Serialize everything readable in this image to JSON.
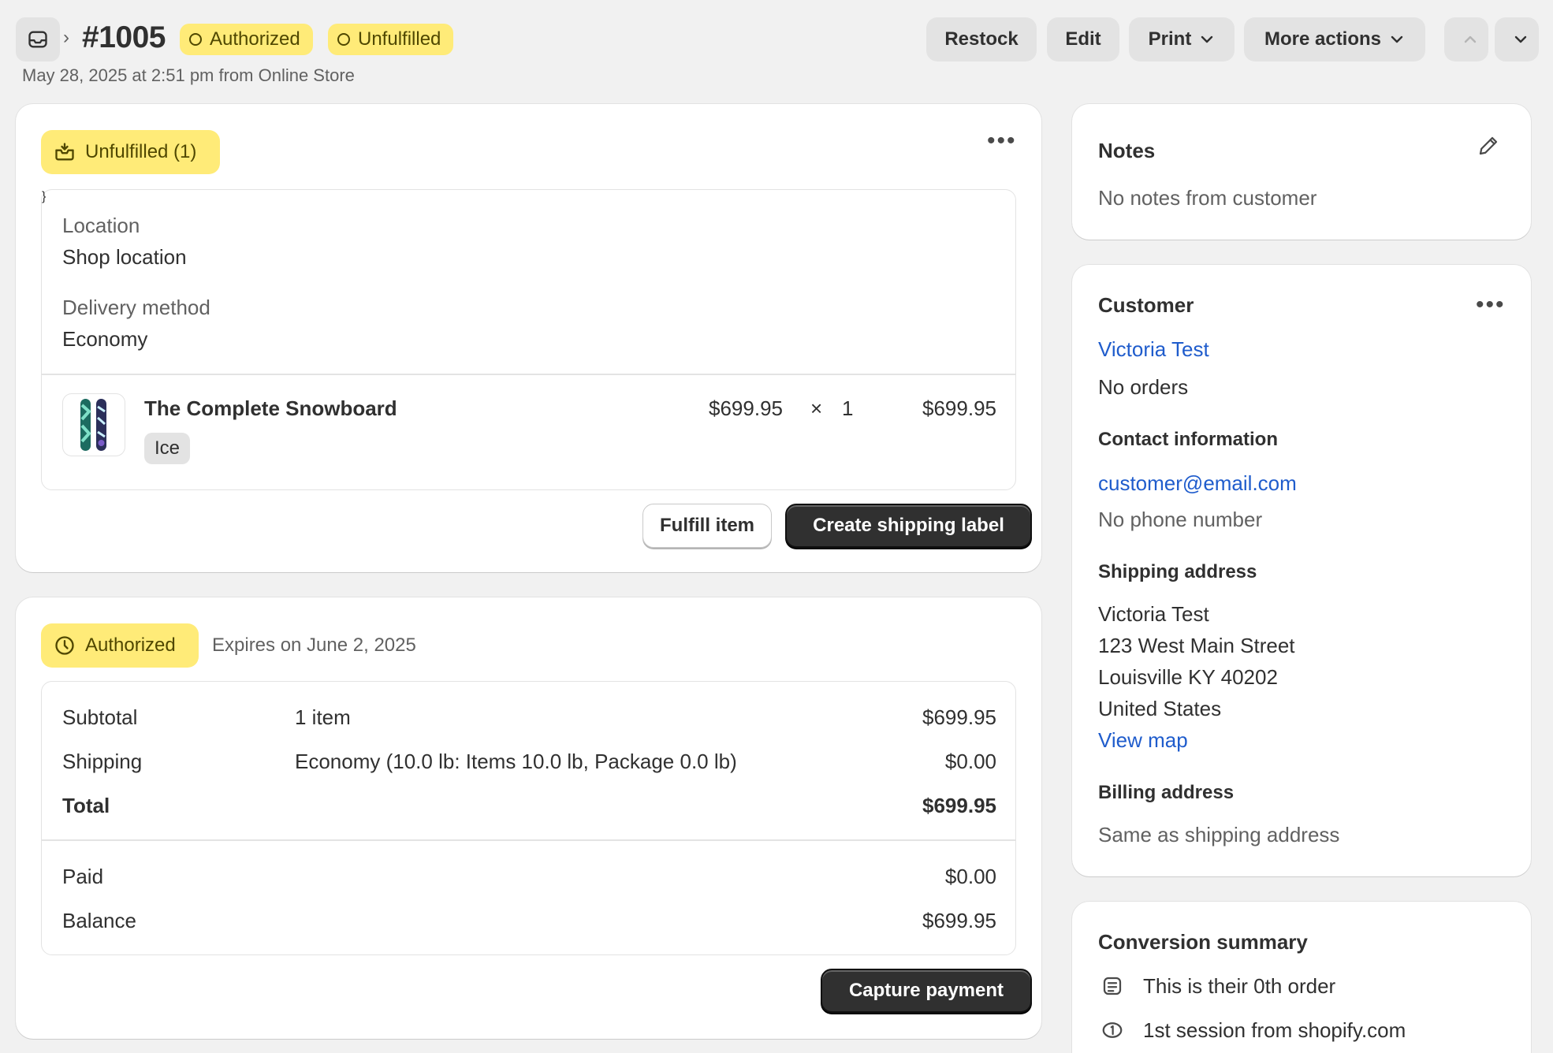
{
  "header": {
    "order_number": "#1005",
    "badges": [
      "Authorized",
      "Unfulfilled"
    ],
    "subtitle": "May 28, 2025 at 2:51 pm from Online Store",
    "actions": {
      "restock": "Restock",
      "edit": "Edit",
      "print": "Print",
      "more": "More actions"
    }
  },
  "fulfillment": {
    "status_label": "Unfulfilled (1)",
    "location_label": "Location",
    "location_value": "Shop location",
    "delivery_label": "Delivery method",
    "delivery_value": "Economy",
    "item": {
      "title": "The Complete Snowboard",
      "variant": "Ice",
      "unit_price": "$699.95",
      "times": "×",
      "quantity": "1",
      "line_total": "$699.95"
    },
    "fulfill_button": "Fulfill item",
    "shipping_label_button": "Create shipping label"
  },
  "payment": {
    "status_label": "Authorized",
    "expires": "Expires on June 2, 2025",
    "rows": [
      {
        "label": "Subtotal",
        "detail": "1 item",
        "amount": "$699.95"
      },
      {
        "label": "Shipping",
        "detail": "Economy (10.0 lb: Items 10.0 lb, Package 0.0 lb)",
        "amount": "$0.00"
      },
      {
        "label": "Total",
        "detail": "",
        "amount": "$699.95"
      }
    ],
    "paid_label": "Paid",
    "paid_amount": "$0.00",
    "balance_label": "Balance",
    "balance_amount": "$699.95",
    "capture_button": "Capture payment"
  },
  "notes": {
    "title": "Notes",
    "body": "No notes from customer"
  },
  "customer": {
    "title": "Customer",
    "name": "Victoria Test",
    "orders": "No orders",
    "contact_title": "Contact information",
    "email": "customer@email.com",
    "phone": "No phone number",
    "shipping_title": "Shipping address",
    "address_lines": [
      "Victoria Test",
      "123 West Main Street",
      "Louisville KY 40202",
      "United States"
    ],
    "view_map": "View map",
    "billing_title": "Billing address",
    "billing_value": "Same as shipping address"
  },
  "conversion": {
    "title": "Conversion summary",
    "items": [
      "This is their 0th order",
      "1st session from shopify.com"
    ]
  },
  "colors": {
    "badge_yellow": "#ffeb78",
    "link_blue": "#1f5ccc",
    "primary_dark": "#303030"
  },
  "icons": [
    "inbox-icon",
    "chevron-right-icon",
    "chevron-down-icon",
    "chevron-up-icon",
    "fulfillment-icon",
    "clock-icon",
    "pencil-icon",
    "more-horizontal-icon",
    "order-stack-icon",
    "session-icon"
  ]
}
